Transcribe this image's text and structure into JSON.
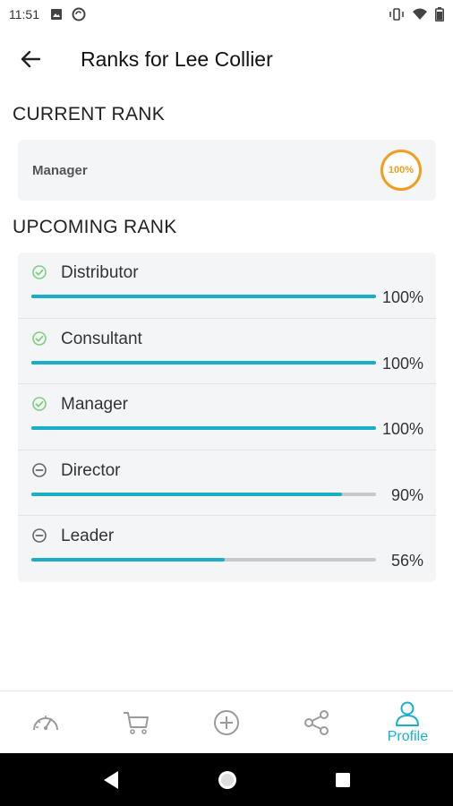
{
  "status_bar": {
    "time": "11:51"
  },
  "header": {
    "title": "Ranks for Lee Collier"
  },
  "current": {
    "section_title": "CURRENT RANK",
    "rank_name": "Manager",
    "progress_label": "100%",
    "progress": 1.0
  },
  "upcoming": {
    "section_title": "UPCOMING RANK",
    "items": [
      {
        "label": "Distributor",
        "percent_label": "100%",
        "progress": 1.0,
        "status": "check-circle-icon"
      },
      {
        "label": "Consultant",
        "percent_label": "100%",
        "progress": 1.0,
        "status": "check-circle-icon"
      },
      {
        "label": "Manager",
        "percent_label": "100%",
        "progress": 1.0,
        "status": "check-circle-icon"
      },
      {
        "label": "Director",
        "percent_label": "90%",
        "progress": 0.9,
        "status": "minus-circle-icon"
      },
      {
        "label": "Leader",
        "percent_label": "56%",
        "progress": 0.56,
        "status": "minus-circle-icon"
      }
    ]
  },
  "bottom_nav": {
    "items": [
      {
        "icon": "dashboard-gauge-icon",
        "label": ""
      },
      {
        "icon": "cart-icon",
        "label": ""
      },
      {
        "icon": "add-circle-icon",
        "label": ""
      },
      {
        "icon": "share-icon",
        "label": ""
      },
      {
        "icon": "profile-icon",
        "label": "Profile"
      }
    ],
    "active_index": 4
  },
  "colors": {
    "accent": "#1aaecb",
    "ring": "#f39c1f",
    "check": "#7ed07e",
    "track": "#c6c8cc",
    "card_bg": "#f4f5f7"
  }
}
